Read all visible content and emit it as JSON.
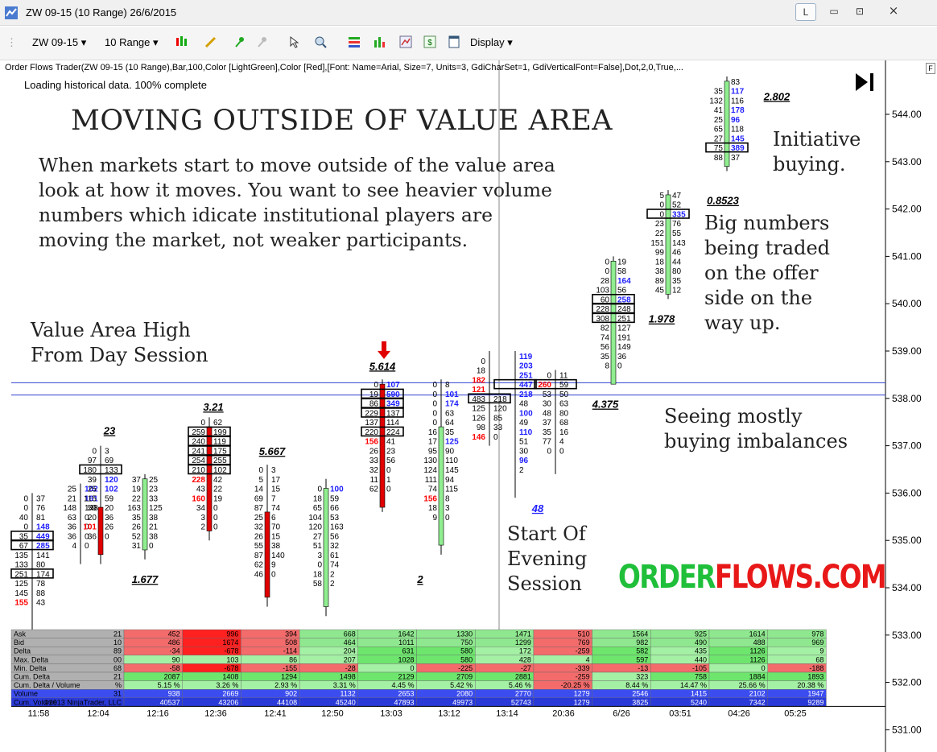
{
  "window": {
    "title": "ZW 09-15 (10 Range)  26/6/2015",
    "btn_l": "L",
    "btn_min": "▭",
    "btn_max": "⊡",
    "btn_close": "⨯"
  },
  "toolbar": {
    "instrument": "ZW 09-15",
    "period": "10 Range",
    "display": "Display"
  },
  "indicator": "Order Flows Trader(ZW 09-15 (10 Range),Bar,100,Color [LightGreen],Color [Red],[Font: Name=Arial, Size=7, Units=3, GdiCharSet=1, GdiVerticalFont=False],Dot,2,0,True,...",
  "loading": "Loading historical data. 100% complete",
  "f_label": "F",
  "annotations": {
    "title": "MOVING OUTSIDE OF VALUE AREA",
    "para": [
      "When markets start to move outside of the value area",
      "look at how it moves. You want to see heavier volume",
      "numbers which idicate institutional players are",
      "moving the market, not weaker participants."
    ],
    "vah": [
      "Value Area High",
      "From Day Session"
    ],
    "initiative": [
      "Initiative",
      "buying."
    ],
    "bignum": [
      "Big numbers",
      "being traded",
      "on the offer",
      "side on the",
      "way up."
    ],
    "seeing": [
      "Seeing mostly",
      "buying imbalances"
    ],
    "evening": [
      "Start Of",
      "Evening",
      "Session"
    ],
    "brand_a": "ORDER",
    "brand_b": "FLOWS.COM"
  },
  "price_axis": [
    "544.00",
    "543.00",
    "542.00",
    "541.00",
    "540.00",
    "539.00",
    "538.00",
    "537.00",
    "536.00",
    "535.00",
    "534.00",
    "533.00",
    "532.00",
    "531.00"
  ],
  "time_axis": [
    "11:58",
    "12:04",
    "12:16",
    "12:36",
    "12:41",
    "12:50",
    "13:03",
    "13:12",
    "13:14",
    "20:36",
    "6/26",
    "03:51",
    "04:26",
    "05:25"
  ],
  "bar_labels": [
    {
      "t": "23",
      "b": 2
    },
    {
      "t": "1.677",
      "b": 3
    },
    {
      "t": "3.21",
      "b": 4
    },
    {
      "t": "5.667",
      "b": 5
    },
    {
      "t": "5.614",
      "b": 7
    },
    {
      "t": "2",
      "b": 8
    },
    {
      "t": "48",
      "b": 10
    },
    {
      "t": "4.375",
      "b": 11
    },
    {
      "t": "1.978",
      "b": 12
    },
    {
      "t": "0.8523",
      "b": 13
    },
    {
      "t": "2.802",
      "b": 14
    }
  ],
  "table": {
    "rows": [
      "Ask",
      "Bid",
      "Delta",
      "Max. Delta",
      "Min. Delta",
      "Cum. Delta",
      "Cum. Delta / Volume",
      "Volume",
      "Cum. Volume"
    ],
    "first": [
      "21",
      "10",
      "89",
      "00",
      "68",
      "21",
      "%",
      "31",
      "©2013 NinjaTrader, LLC"
    ],
    "cols": [
      [
        "452",
        "486",
        "-34",
        "90",
        "-58",
        "2087",
        "5.15 %",
        "938",
        "40537"
      ],
      [
        "996",
        "1674",
        "-678",
        "103",
        "-678",
        "1408",
        "3.26 %",
        "2669",
        "43206"
      ],
      [
        "394",
        "508",
        "-114",
        "86",
        "-155",
        "1294",
        "2.93 %",
        "902",
        "44108"
      ],
      [
        "668",
        "464",
        "204",
        "207",
        "-28",
        "1498",
        "3.31 %",
        "1132",
        "45240"
      ],
      [
        "1642",
        "1011",
        "631",
        "1028",
        "0",
        "2129",
        "4.45 %",
        "2653",
        "47893"
      ],
      [
        "1330",
        "750",
        "580",
        "580",
        "-225",
        "2709",
        "5.42 %",
        "2080",
        "49973"
      ],
      [
        "1471",
        "1299",
        "172",
        "428",
        "-27",
        "2881",
        "5.46 %",
        "2770",
        "52743"
      ],
      [
        "510",
        "769",
        "-259",
        "4",
        "-339",
        "-259",
        "-20.25 %",
        "1279",
        "1279"
      ],
      [
        "1564",
        "982",
        "582",
        "597",
        "-13",
        "323",
        "8.44 %",
        "2546",
        "3825"
      ],
      [
        "925",
        "490",
        "435",
        "440",
        "-105",
        "758",
        "14.47 %",
        "1415",
        "5240"
      ],
      [
        "1614",
        "488",
        "1126",
        "1126",
        "0",
        "1884",
        "25.66 %",
        "2102",
        "7342"
      ],
      [
        "978",
        "969",
        "9",
        "68",
        "-188",
        "1893",
        "20.38 %",
        "1947",
        "9289"
      ]
    ]
  },
  "bars": [
    {
      "hi": 536.0,
      "lo": 532.6,
      "o": 535.0,
      "c": 535.0,
      "col": "none",
      "rows": [
        [
          535.9,
          "0",
          "37"
        ],
        [
          535.7,
          "0",
          "76"
        ],
        [
          535.5,
          "40",
          "81"
        ],
        [
          535.3,
          "0",
          "148"
        ],
        [
          535.1,
          "35",
          "449"
        ],
        [
          534.9,
          "67",
          "285"
        ],
        [
          534.7,
          "135",
          "141"
        ],
        [
          534.5,
          "133",
          "80"
        ],
        [
          534.3,
          "251",
          "174"
        ],
        [
          534.1,
          "125",
          "78"
        ],
        [
          533.9,
          "145",
          "88"
        ],
        [
          533.7,
          "155",
          "43"
        ]
      ]
    },
    {
      "hi": 536.2,
      "lo": 534.5,
      "o": 535.5,
      "c": 534.6,
      "col": "none",
      "rows": [
        [
          536.1,
          "25",
          "102"
        ],
        [
          535.9,
          "21",
          "161"
        ],
        [
          535.7,
          "148",
          "148"
        ],
        [
          535.5,
          "63",
          "0"
        ],
        [
          535.3,
          "36",
          "0"
        ],
        [
          535.1,
          "36",
          "0"
        ],
        [
          534.9,
          "4",
          "0"
        ],
        [
          534.7,
          "",
          ""
        ]
      ]
    },
    {
      "hi": 537.0,
      "lo": 534.5,
      "o": 535.7,
      "c": 534.7,
      "col": "red",
      "rows": [
        [
          536.9,
          "0",
          "3"
        ],
        [
          536.7,
          "97",
          "69"
        ],
        [
          536.5,
          "180",
          "133"
        ],
        [
          536.3,
          "39",
          "120"
        ],
        [
          536.1,
          "25",
          "102"
        ],
        [
          535.9,
          "115",
          "59"
        ],
        [
          535.7,
          "59",
          "20"
        ],
        [
          535.5,
          "20",
          "36"
        ],
        [
          535.3,
          "101",
          "26"
        ],
        [
          535.1,
          "36",
          "0"
        ]
      ]
    },
    {
      "hi": 536.4,
      "lo": 534.6,
      "o": 534.8,
      "c": 536.3,
      "col": "green",
      "rows": [
        [
          536.3,
          "37",
          "25"
        ],
        [
          536.1,
          "19",
          "23"
        ],
        [
          535.9,
          "22",
          "33"
        ],
        [
          535.7,
          "163",
          "125"
        ],
        [
          535.5,
          "35",
          "38"
        ],
        [
          535.3,
          "26",
          "21"
        ],
        [
          535.1,
          "52",
          "38"
        ],
        [
          534.9,
          "31",
          "0"
        ]
      ]
    },
    {
      "hi": 537.6,
      "lo": 535.0,
      "o": 537.4,
      "c": 535.2,
      "col": "red",
      "rows": [
        [
          537.5,
          "0",
          "62"
        ],
        [
          537.3,
          "259",
          "199"
        ],
        [
          537.1,
          "240",
          "119"
        ],
        [
          536.9,
          "241",
          "175"
        ],
        [
          536.7,
          "254",
          "255"
        ],
        [
          536.5,
          "210",
          "102"
        ],
        [
          536.3,
          "228",
          "42"
        ],
        [
          536.1,
          "43",
          "22"
        ],
        [
          535.9,
          "160",
          "19"
        ],
        [
          535.7,
          "34",
          "0"
        ],
        [
          535.5,
          "3",
          "0"
        ],
        [
          535.3,
          "2",
          "0"
        ]
      ]
    },
    {
      "hi": 536.6,
      "lo": 533.6,
      "o": 535.6,
      "c": 533.8,
      "col": "red",
      "rows": [
        [
          536.5,
          "0",
          "3"
        ],
        [
          536.3,
          "5",
          "17"
        ],
        [
          536.1,
          "14",
          "15"
        ],
        [
          535.9,
          "69",
          "7"
        ],
        [
          535.7,
          "87",
          "74"
        ],
        [
          535.5,
          "25",
          "6"
        ],
        [
          535.3,
          "32",
          "70"
        ],
        [
          535.1,
          "26",
          "15"
        ],
        [
          534.9,
          "55",
          "38"
        ],
        [
          534.7,
          "87",
          "140"
        ],
        [
          534.5,
          "62",
          "9"
        ],
        [
          534.3,
          "46",
          "0"
        ]
      ]
    },
    {
      "hi": 536.3,
      "lo": 533.4,
      "o": 533.6,
      "c": 536.1,
      "col": "green",
      "rows": [
        [
          536.1,
          "0",
          "100"
        ],
        [
          535.9,
          "18",
          "59"
        ],
        [
          535.7,
          "65",
          "66"
        ],
        [
          535.5,
          "104",
          "53"
        ],
        [
          535.3,
          "120",
          "163"
        ],
        [
          535.1,
          "27",
          "56"
        ],
        [
          534.9,
          "51",
          "32"
        ],
        [
          534.7,
          "3",
          "61"
        ],
        [
          534.5,
          "0",
          "74"
        ],
        [
          534.3,
          "18",
          "2"
        ],
        [
          534.1,
          "58",
          "2"
        ]
      ]
    },
    {
      "hi": 538.4,
      "lo": 535.6,
      "o": 538.3,
      "c": 535.7,
      "col": "red",
      "rows": [
        [
          538.3,
          "0",
          "107"
        ],
        [
          538.1,
          "19",
          "590"
        ],
        [
          537.9,
          "86",
          "349"
        ],
        [
          537.7,
          "229",
          "137"
        ],
        [
          537.5,
          "137",
          "114"
        ],
        [
          537.3,
          "220",
          "224"
        ],
        [
          537.1,
          "156",
          "41"
        ],
        [
          536.9,
          "26",
          "23"
        ],
        [
          536.7,
          "33",
          "56"
        ],
        [
          536.5,
          "32",
          "0"
        ],
        [
          536.3,
          "11",
          "1"
        ],
        [
          536.1,
          "62",
          "0"
        ]
      ]
    },
    {
      "hi": 538.4,
      "lo": 534.7,
      "o": 534.9,
      "c": 537.4,
      "col": "green",
      "rows": [
        [
          538.3,
          "0",
          "8"
        ],
        [
          538.1,
          "0",
          "101"
        ],
        [
          537.9,
          "0",
          "174"
        ],
        [
          537.7,
          "0",
          "63"
        ],
        [
          537.5,
          "0",
          "64"
        ],
        [
          537.3,
          "16",
          "35"
        ],
        [
          537.1,
          "17",
          "125"
        ],
        [
          536.9,
          "95",
          "90"
        ],
        [
          536.7,
          "130",
          "110"
        ],
        [
          536.5,
          "124",
          "145"
        ],
        [
          536.3,
          "111",
          "94"
        ],
        [
          536.1,
          "74",
          "115"
        ],
        [
          535.9,
          "156",
          "8"
        ],
        [
          535.7,
          "18",
          "3"
        ],
        [
          535.5,
          "9",
          "0"
        ]
      ]
    },
    {
      "hi": 539.0,
      "lo": 537.0,
      "o": 537.5,
      "c": 538.5,
      "col": "none",
      "rows": [
        [
          538.8,
          "0",
          ""
        ],
        [
          538.6,
          "18",
          ""
        ],
        [
          538.4,
          "182",
          ""
        ],
        [
          538.2,
          "121",
          ""
        ],
        [
          538.0,
          "483",
          "218"
        ],
        [
          537.8,
          "125",
          "120"
        ],
        [
          537.6,
          "126",
          "85"
        ],
        [
          537.4,
          "98",
          "33"
        ],
        [
          537.2,
          "146",
          "0"
        ]
      ]
    },
    {
      "hi": 539.0,
      "lo": 535.9,
      "o": 538.7,
      "c": 536.0,
      "col": "none",
      "rows": [
        [
          538.9,
          "",
          "119"
        ],
        [
          538.7,
          "",
          "203"
        ],
        [
          538.5,
          "",
          "251"
        ],
        [
          538.3,
          "",
          "447"
        ],
        [
          538.1,
          "",
          "218"
        ],
        [
          537.9,
          "",
          "48"
        ],
        [
          537.7,
          "",
          "100"
        ],
        [
          537.5,
          "",
          "49"
        ],
        [
          537.3,
          "",
          "110"
        ],
        [
          537.1,
          "",
          "51"
        ],
        [
          536.9,
          "",
          "30"
        ],
        [
          536.7,
          "",
          "96"
        ],
        [
          536.5,
          "",
          "2"
        ]
      ]
    },
    {
      "hi": 538.6,
      "lo": 536.4,
      "o": 538.6,
      "c": 536.5,
      "col": "none",
      "rows": [
        [
          538.5,
          "0",
          "11"
        ],
        [
          538.3,
          "260",
          "59"
        ],
        [
          538.1,
          "53",
          "50"
        ],
        [
          537.9,
          "30",
          "63"
        ],
        [
          537.7,
          "48",
          "80"
        ],
        [
          537.5,
          "37",
          "68"
        ],
        [
          537.3,
          "35",
          "16"
        ],
        [
          537.1,
          "77",
          "4"
        ],
        [
          536.9,
          "0",
          "0"
        ]
      ]
    },
    {
      "hi": 541.0,
      "lo": 538.3,
      "o": 538.3,
      "c": 540.9,
      "col": "green",
      "rows": [
        [
          540.9,
          "0",
          "19"
        ],
        [
          540.7,
          "0",
          "58"
        ],
        [
          540.5,
          "28",
          "164"
        ],
        [
          540.3,
          "103",
          "56"
        ],
        [
          540.1,
          "60",
          "258"
        ],
        [
          539.9,
          "228",
          "248"
        ],
        [
          539.7,
          "308",
          "251"
        ],
        [
          539.5,
          "82",
          "127"
        ],
        [
          539.3,
          "74",
          "191"
        ],
        [
          539.1,
          "56",
          "149"
        ],
        [
          538.9,
          "35",
          "36"
        ],
        [
          538.7,
          "8",
          "0"
        ]
      ]
    },
    {
      "hi": 542.4,
      "lo": 540.1,
      "o": 540.2,
      "c": 542.3,
      "col": "green",
      "rows": [
        [
          542.3,
          "5",
          "47"
        ],
        [
          542.1,
          "0",
          "52"
        ],
        [
          541.9,
          "0",
          "335"
        ],
        [
          541.7,
          "23",
          "76"
        ],
        [
          541.5,
          "22",
          "55"
        ],
        [
          541.3,
          "151",
          "143"
        ],
        [
          541.1,
          "99",
          "46"
        ],
        [
          540.9,
          "18",
          "44"
        ],
        [
          540.7,
          "38",
          "80"
        ],
        [
          540.5,
          "89",
          "35"
        ],
        [
          540.3,
          "45",
          "12"
        ]
      ]
    },
    {
      "hi": 544.8,
      "lo": 542.8,
      "o": 542.9,
      "c": 544.7,
      "col": "green",
      "rows": [
        [
          544.7,
          "",
          "83"
        ],
        [
          544.5,
          "35",
          "117"
        ],
        [
          544.3,
          "132",
          "116"
        ],
        [
          544.1,
          "41",
          "178"
        ],
        [
          543.9,
          "25",
          "96"
        ],
        [
          543.7,
          "65",
          "118"
        ],
        [
          543.5,
          "27",
          "145"
        ],
        [
          543.3,
          "75",
          "389"
        ],
        [
          543.1,
          "88",
          "37"
        ]
      ]
    }
  ],
  "colors": {
    "green": "#90ee90",
    "red": "#e00000",
    "blue": "#2020ff",
    "redtext": "#ff0000",
    "brand_green": "#1fbf3a",
    "brand_red": "#e81818"
  }
}
